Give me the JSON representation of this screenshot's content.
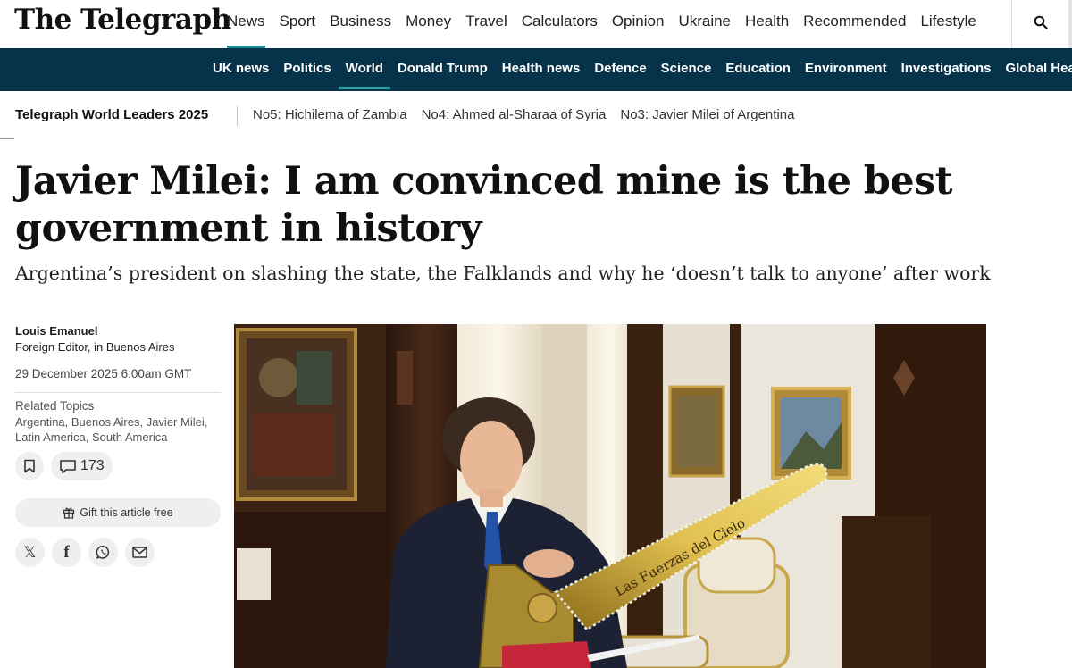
{
  "header": {
    "logo": "The Telegraph",
    "nav": [
      "News",
      "Sport",
      "Business",
      "Money",
      "Travel",
      "Calculators",
      "Opinion",
      "Ukraine",
      "Health",
      "Recommended",
      "Lifestyle"
    ],
    "active_nav": "News"
  },
  "subnav": {
    "items": [
      "UK news",
      "Politics",
      "World",
      "Donald Trump",
      "Health news",
      "Defence",
      "Science",
      "Education",
      "Environment",
      "Investigations",
      "Global Health"
    ],
    "active": "World"
  },
  "series": {
    "label": "Telegraph World Leaders 2025",
    "links": [
      "No5: Hichilema of Zambia",
      "No4: Ahmed al-Sharaa of Syria",
      "No3: Javier Milei of Argentina"
    ]
  },
  "article": {
    "headline": "Javier Milei: I am convinced mine is the best government in history",
    "standfirst": "Argentina’s president on slashing the state, the Falklands and why he ‘doesn’t talk to anyone’ after work",
    "author": "Louis Emanuel",
    "role": "Foreign Editor, in Buenos Aires",
    "date": "29 December 2025 6:00am GMT",
    "topics_heading": "Related Topics",
    "topics": "Argentina, Buenos Aires, Javier Milei, Latin America, South America",
    "comment_count": "173",
    "gift_label": "Gift this article free"
  },
  "image": {
    "chainsaw_text": "Las Fuerzas del Cielo"
  },
  "colors": {
    "accent": "#1d8c94",
    "subnav_bg": "#063349",
    "pill_bg": "#efefef"
  },
  "icons": [
    "search-icon",
    "bookmark-icon",
    "comment-icon",
    "gift-icon",
    "x-icon",
    "facebook-icon",
    "whatsapp-icon",
    "email-icon"
  ]
}
